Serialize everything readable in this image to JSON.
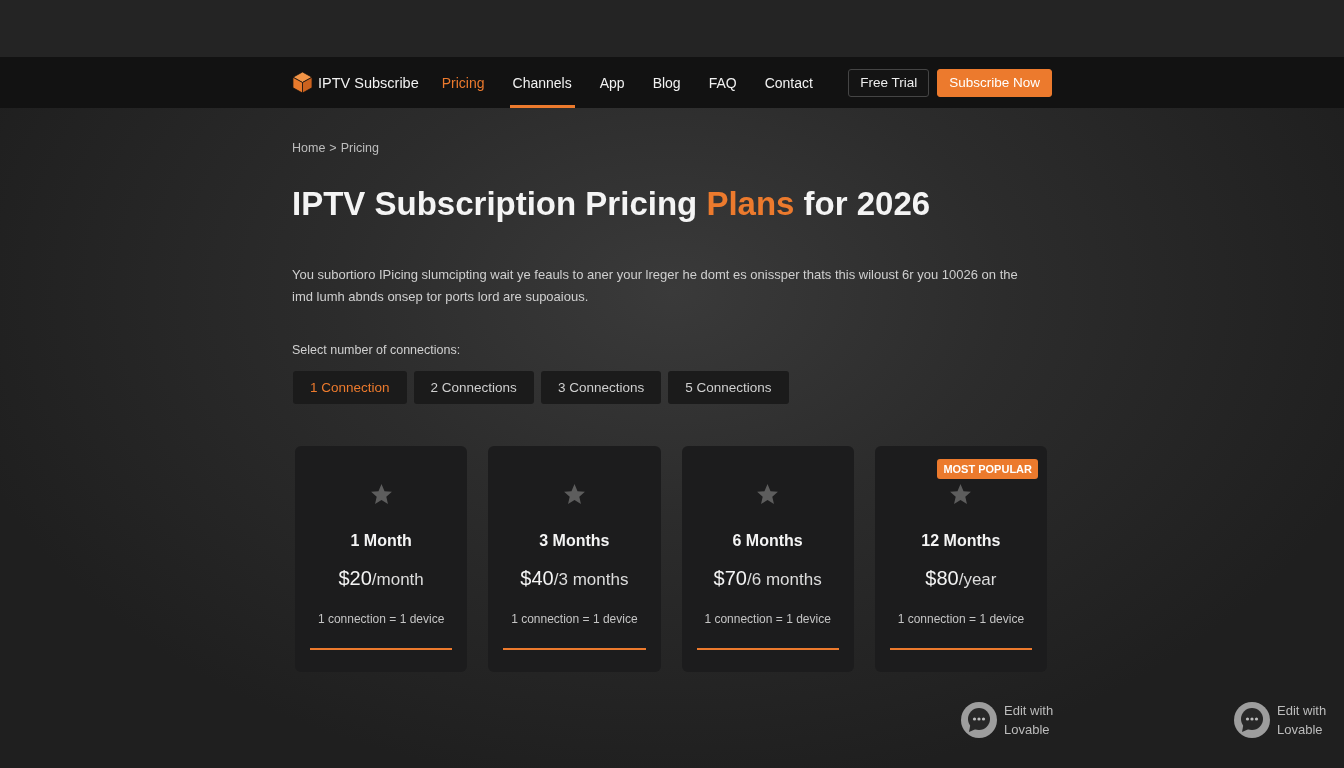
{
  "header": {
    "brand": "IPTV Subscribe",
    "nav": [
      {
        "label": "Pricing",
        "current": true,
        "selected": false
      },
      {
        "label": "Channels",
        "current": false,
        "selected": true
      },
      {
        "label": "App",
        "current": false,
        "selected": false
      },
      {
        "label": "Blog",
        "current": false,
        "selected": false
      },
      {
        "label": "FAQ",
        "current": false,
        "selected": false
      },
      {
        "label": "Contact",
        "current": false,
        "selected": false
      }
    ],
    "buttons": [
      {
        "label": "Free Trial",
        "kind": "outline"
      },
      {
        "label": "Subscribe Now",
        "kind": "filled"
      }
    ]
  },
  "breadcrumb": {
    "items": [
      "Home",
      "Pricing"
    ],
    "separator": ">"
  },
  "title": {
    "before": "IPTV Subscription Pricing",
    "accent": "Plans",
    "after": "for 2026"
  },
  "intro": "You subortioro IPicing slumcipting wait ye feauls to aner your lreger he domt es onissper thats this wiloust 6r you 10026 on the imd lumh abnds onsep tor ports lord are supoaious.",
  "connections": {
    "label": "Select number of connections:",
    "options": [
      {
        "label": "1 Connection",
        "selected": true
      },
      {
        "label": "2 Connections",
        "selected": false
      },
      {
        "label": "3 Connections",
        "selected": false
      },
      {
        "label": "5 Connections",
        "selected": false
      }
    ]
  },
  "plans": [
    {
      "name": "1 Month",
      "amount": "$20",
      "period": "/month",
      "note": "1 connection = 1 device"
    },
    {
      "name": "3 Months",
      "amount": "$40",
      "period": "/3 months",
      "note": "1 connection = 1 device"
    },
    {
      "name": "6 Months",
      "amount": "$70",
      "period": "/6 months",
      "note": "1 connection = 1 device"
    },
    {
      "name": "12 Months",
      "amount": "$80",
      "period": "/year",
      "note": "1 connection = 1 device",
      "badge": "MOST POPULAR"
    }
  ],
  "floating_links": [
    {
      "label": "Edit with Lovable"
    },
    {
      "label": "Edit with Lovable"
    }
  ]
}
